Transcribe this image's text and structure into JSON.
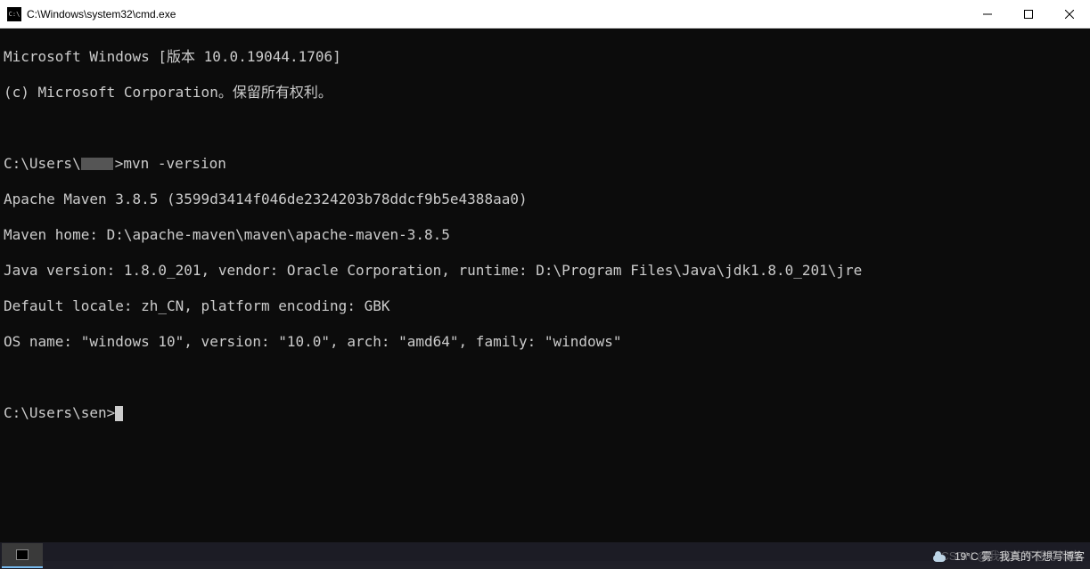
{
  "window": {
    "title": "C:\\Windows\\system32\\cmd.exe",
    "icon_name": "cmd-icon",
    "buttons": {
      "minimize": "Minimize",
      "maximize": "Maximize",
      "close": "Close"
    }
  },
  "terminal": {
    "lines": [
      "Microsoft Windows [版本 10.0.19044.1706]",
      "(c) Microsoft Corporation。保留所有权利。",
      "",
      "",
      "Apache Maven 3.8.5 (3599d3414f046de2324203b78ddcf9b5e4388aa0)",
      "Maven home: D:\\apache-maven\\maven\\apache-maven-3.8.5",
      "Java version: 1.8.0_201, vendor: Oracle Corporation, runtime: D:\\Program Files\\Java\\jdk1.8.0_201\\jre",
      "Default locale: zh_CN, platform encoding: GBK",
      "OS name: \"windows 10\", version: \"10.0\", arch: \"amd64\", family: \"windows\"",
      "",
      "C:\\Users\\sen>"
    ],
    "prompt_prefix": "C:\\Users\\",
    "prompt_suffix": ">mvn -version",
    "redacted_user": "[redacted]"
  },
  "taskbar": {
    "app": "cmd.exe",
    "weather_temp": "19°C 雾",
    "tray_text": "我真的不想写博客"
  },
  "watermark": "CSDN @我真的不想写博客"
}
